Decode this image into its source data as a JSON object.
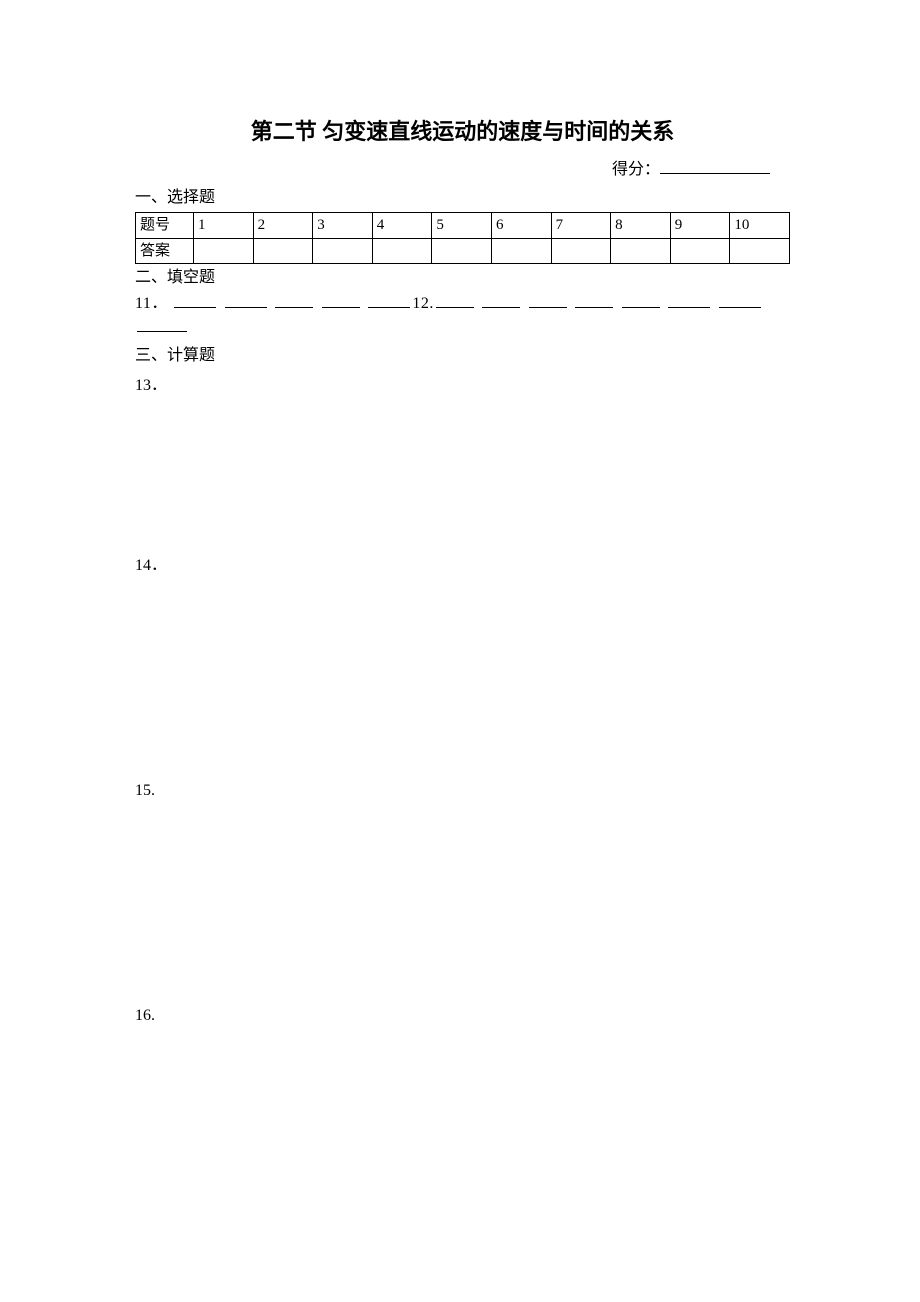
{
  "title": "第二节  匀变速直线运动的速度与时间的关系",
  "score": {
    "label": "得分："
  },
  "sections": {
    "s1": {
      "heading": "一、选择题"
    },
    "s2": {
      "heading": "二、填空题"
    },
    "s3": {
      "heading": "三、计算题"
    }
  },
  "table": {
    "rowLabelQuestion": "题号",
    "rowLabelAnswer": "答案",
    "cols": [
      "1",
      "2",
      "3",
      "4",
      "5",
      "6",
      "7",
      "8",
      "9",
      "10"
    ]
  },
  "fill": {
    "q11": "11．",
    "q12": "12."
  },
  "calc": {
    "q13": "13．",
    "q14": "14．",
    "q15": "15.",
    "q16": "16."
  }
}
